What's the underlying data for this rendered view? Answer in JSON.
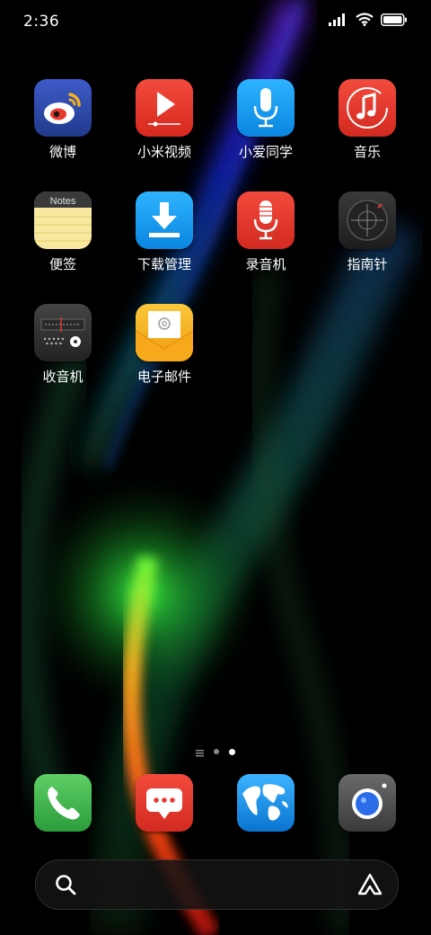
{
  "status_bar": {
    "time": "2:36",
    "icons": [
      "signal-icon",
      "wifi-icon",
      "battery-icon"
    ]
  },
  "apps": [
    {
      "label": "微博",
      "icon": "weibo-icon",
      "color": "#2f49a8"
    },
    {
      "label": "小米视频",
      "icon": "video-play-icon",
      "color": "#e8392e"
    },
    {
      "label": "小爱同学",
      "icon": "microphone-icon",
      "color": "#1a9df0"
    },
    {
      "label": "音乐",
      "icon": "music-note-icon",
      "color": "#e63b32"
    },
    {
      "label": "便签",
      "icon": "notes-icon",
      "color": "#f7e9a0",
      "icon_text": "Notes"
    },
    {
      "label": "下载管理",
      "icon": "download-icon",
      "color": "#1e9ef2"
    },
    {
      "label": "录音机",
      "icon": "recorder-mic-icon",
      "color": "#e63b32"
    },
    {
      "label": "指南针",
      "icon": "compass-icon",
      "color": "#2b2b2b"
    },
    {
      "label": "收音机",
      "icon": "radio-icon",
      "color": "#333333"
    },
    {
      "label": "电子邮件",
      "icon": "email-icon",
      "color": "#f6b21b"
    }
  ],
  "page_indicator": {
    "pages": 3,
    "current": 3
  },
  "dock": [
    {
      "name": "phone",
      "icon": "phone-icon",
      "color": "#3cb54a"
    },
    {
      "name": "messages",
      "icon": "message-icon",
      "color": "#e63b32"
    },
    {
      "name": "browser",
      "icon": "globe-icon",
      "color": "#1a8de0"
    },
    {
      "name": "camera",
      "icon": "camera-icon",
      "color": "#555555"
    }
  ]
}
